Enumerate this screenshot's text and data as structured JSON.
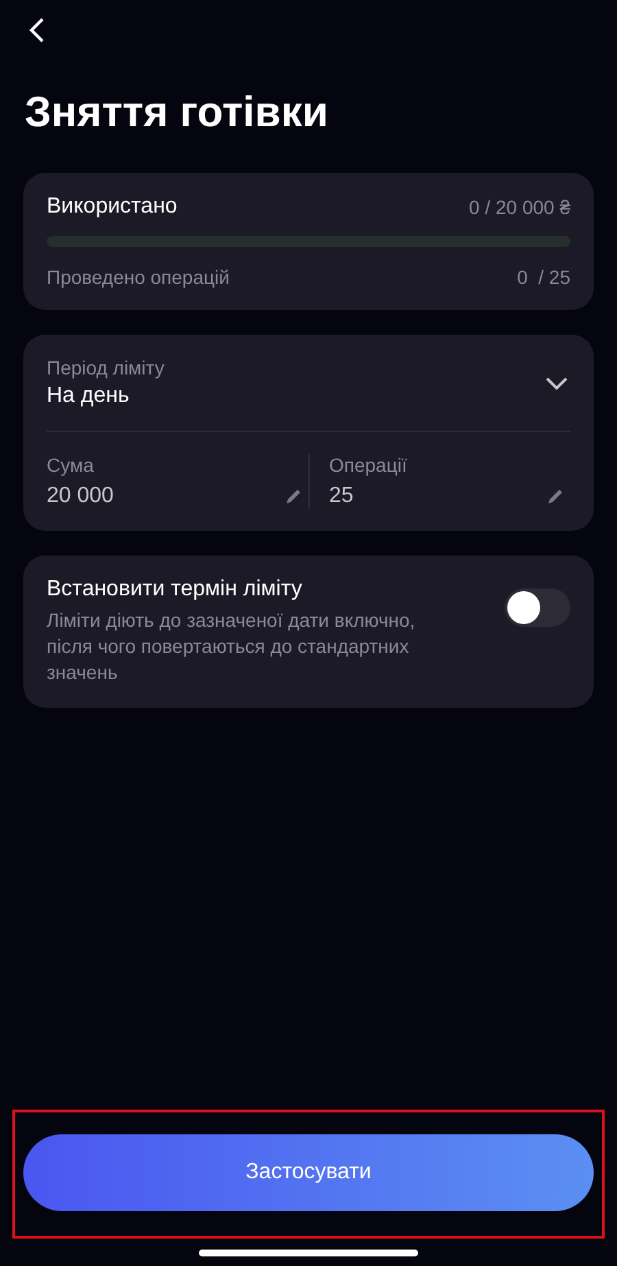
{
  "title": "Зняття готівки",
  "usage": {
    "label": "Використано",
    "used": "0",
    "limit": "/ 20 000 ₴",
    "level": 0,
    "operations_label": "Проведено операцій",
    "operations_done": "0",
    "operations_limit": "/ 25"
  },
  "limit": {
    "period_label": "Період ліміту",
    "period_value": "На день",
    "expanded": false,
    "fields": [
      {
        "label": "Сума",
        "value": "20 000"
      },
      {
        "label": "Операції",
        "value": "25"
      }
    ]
  },
  "term": {
    "title": "Встановити термін ліміту",
    "description": "Ліміти діють до зазначеної дати включно, після чого повертаються до стандартних значень",
    "on": false
  },
  "apply_button": "Застосувати"
}
